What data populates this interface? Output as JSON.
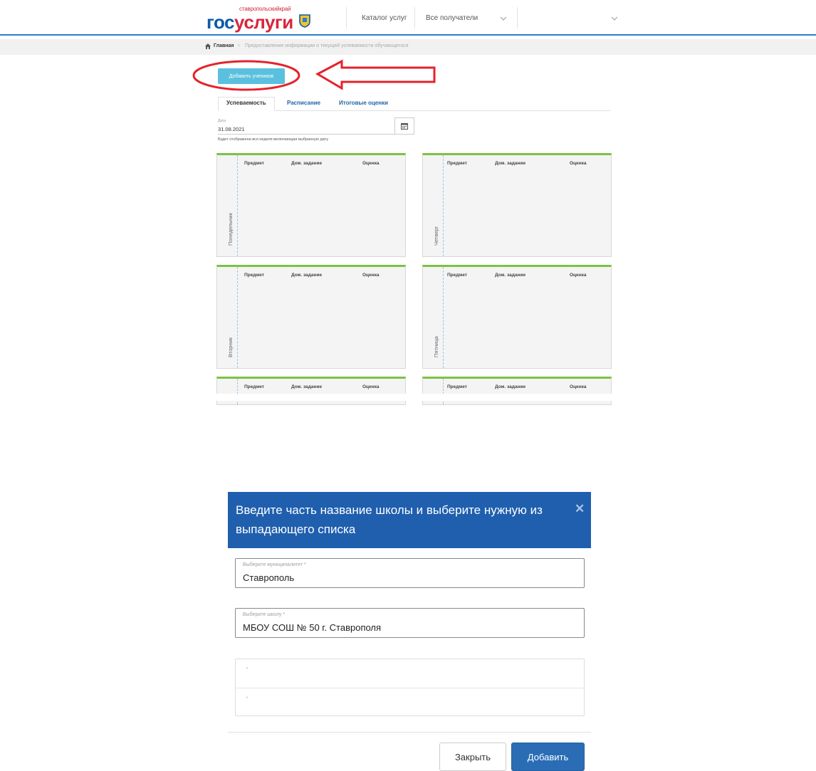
{
  "header": {
    "logo_region": "ставропольскийкрай",
    "logo_part1": "гос",
    "logo_part2": "услуги",
    "nav_catalog": "Каталог услуг",
    "nav_recipients": "Все получатели"
  },
  "breadcrumb": {
    "home": "Главная",
    "current": "Предоставление информации о текущей успеваемости обучающегося"
  },
  "add_students_button": "Добавить учеников",
  "tabs": [
    {
      "label": "Успеваемость",
      "active": true
    },
    {
      "label": "Расписание",
      "active": false
    },
    {
      "label": "Итоговые оценки",
      "active": false
    }
  ],
  "date": {
    "label": "Дата",
    "value": "31.08.2021",
    "hint": "Будет отображена вся неделя включающая выбранную дату"
  },
  "columns": {
    "subject": "Предмет",
    "homework": "Дом. задание",
    "grade": "Оценка"
  },
  "days": {
    "monday": "Понедельник",
    "thursday": "Четверг",
    "tuesday": "Вторник",
    "friday": "Пятница"
  },
  "modal": {
    "title": "Введите часть название школы и выберите нужную из выпадающего списка",
    "municipality_label": "Выберите муниципалитет *",
    "municipality_value": "Ставрополь",
    "school_label": "Выберите школу *",
    "school_value": "МБОУ СОШ № 50 г. Ставрополя",
    "list_items": [
      "'",
      "'"
    ],
    "close_button": "Закрыть",
    "add_button": "Добавить"
  },
  "colors": {
    "brand_blue": "#0b5aa7",
    "brand_red": "#d6273c",
    "modal_header": "#1f5fae",
    "card_accent": "#7cc244",
    "add_students_bg": "#5bc0de"
  }
}
